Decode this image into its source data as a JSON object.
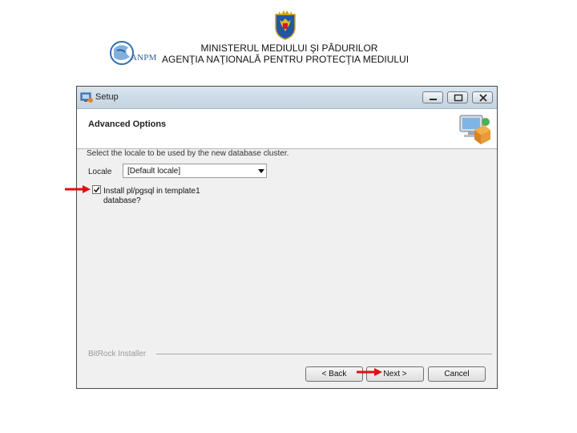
{
  "header": {
    "line1": "MINISTERUL MEDIULUI ŞI PĂDURILOR",
    "line2": "AGENŢIA NAŢIONALĂ PENTRU PROTECŢIA MEDIULUI",
    "logo_text": "ANPM"
  },
  "window": {
    "title": "Setup",
    "page_title": "Advanced Options",
    "instruction": "Select the locale to be used by the new database cluster.",
    "locale_label": "Locale",
    "locale_value": "[Default locale]",
    "checkbox_label": "Install pl/pgsql in template1 database?",
    "checkbox_checked": true,
    "brand": "BitRock Installer",
    "buttons": {
      "back": "< Back",
      "next": "Next >",
      "cancel": "Cancel"
    }
  },
  "colors": {
    "pointer_arrow": "#e01010",
    "titlebar": "#c5d3e1",
    "dialog_bg": "#f0f0f0"
  }
}
